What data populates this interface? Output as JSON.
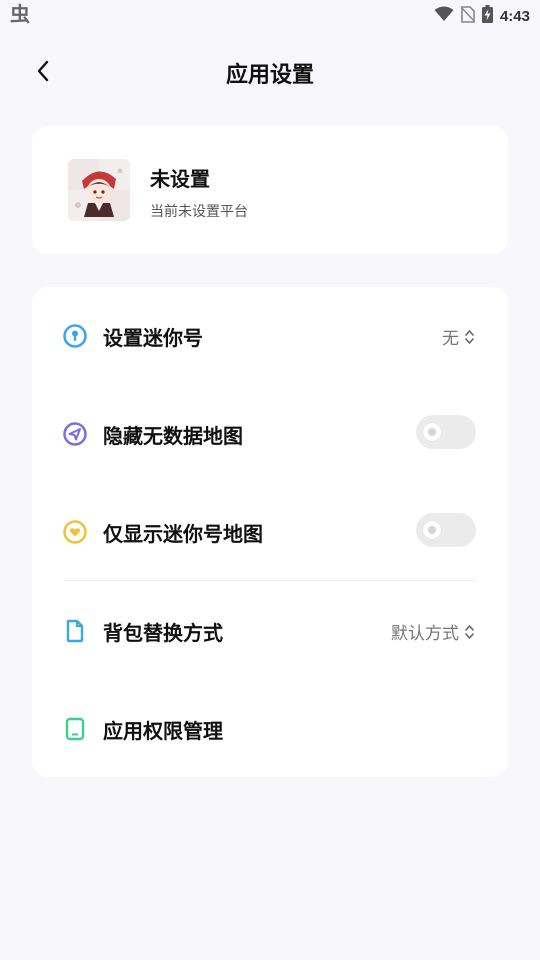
{
  "status_bar": {
    "app_icon": "虫",
    "time": "4:43",
    "icons": [
      "wifi-icon",
      "no-sim-icon",
      "battery-charging-icon"
    ]
  },
  "header": {
    "title": "应用设置",
    "back_icon": "chevron-left-icon"
  },
  "profile": {
    "name": "未设置",
    "subtitle": "当前未设置平台",
    "avatar": "anime-character-avatar"
  },
  "settings": {
    "items": [
      {
        "label": "设置迷你号",
        "icon": "key-circle-icon",
        "icon_color": "#3aa6e8",
        "value": "无",
        "control": "select"
      },
      {
        "label": "隐藏无数据地图",
        "icon": "send-circle-icon",
        "icon_color": "#7b6ee0",
        "control": "toggle",
        "on": false
      },
      {
        "label": "仅显示迷你号地图",
        "icon": "heart-circle-icon",
        "icon_color": "#f0c23a",
        "control": "toggle",
        "on": false
      },
      {
        "label": "背包替换方式",
        "icon": "document-icon",
        "icon_color": "#3aa6e8",
        "value": "默认方式",
        "control": "select"
      },
      {
        "label": "应用权限管理",
        "icon": "tablet-icon",
        "icon_color": "#3ecf8e",
        "control": "none"
      }
    ]
  },
  "colors": {
    "background": "#f8f7fc",
    "card": "#ffffff",
    "toggle_off": "#ebebeb"
  }
}
